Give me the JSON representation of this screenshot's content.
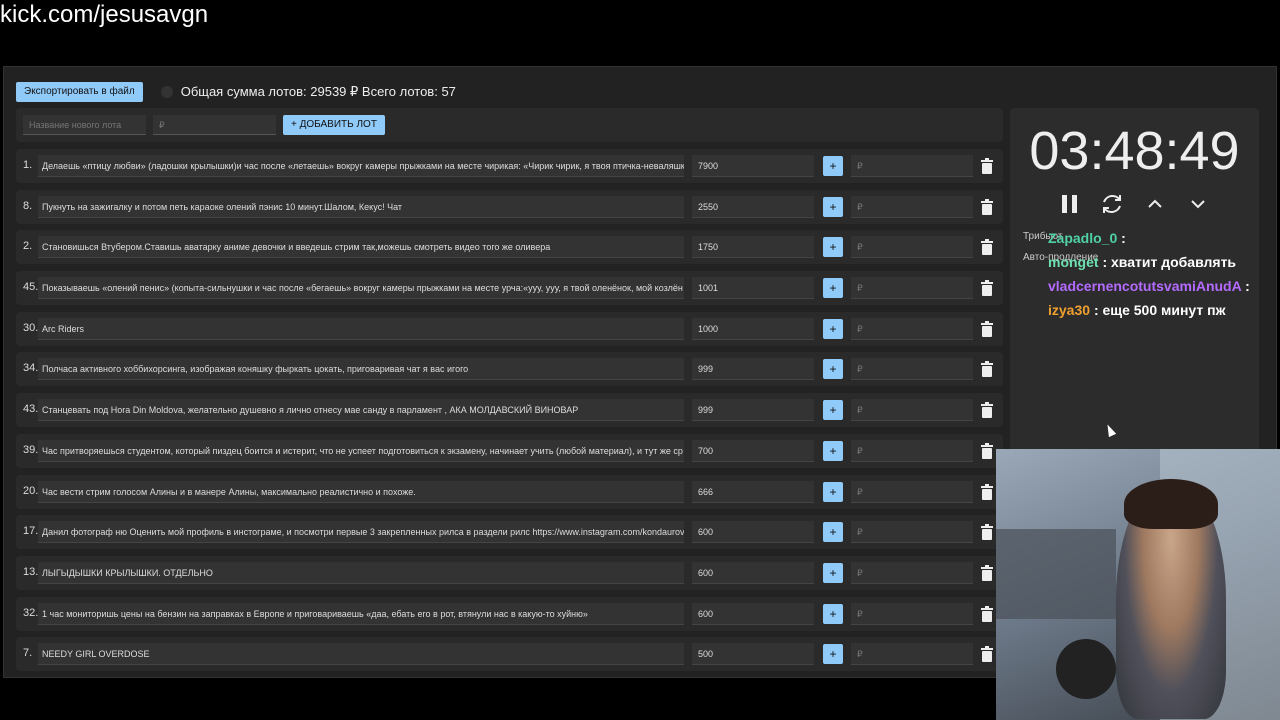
{
  "url": "kick.com/jesusavgn",
  "toolbar": {
    "export_label": "Экспортировать в файл",
    "total_text": "Общая сумма лотов: 29539 ₽ Всего лотов: 57"
  },
  "new_lot": {
    "name_placeholder": "Название нового лота",
    "amount_placeholder": "₽",
    "add_label": "+ ДОБАВИТЬ ЛОТ"
  },
  "lots": [
    {
      "num": "1.",
      "name": "Делаешь «птицу любви» (ладошки крылышки)и час после «летаешь» вокруг камеры прыжками на месте чирикая: «Чирик чирик, я твоя птичка-неваляшка",
      "amount": "7900",
      "rub": "₽"
    },
    {
      "num": "8.",
      "name": "Пукнуть на зажигалку и потом петь караоке олений пэнис 10 минут.Шалом, Кекус! Чат",
      "amount": "2550",
      "rub": "₽"
    },
    {
      "num": "2.",
      "name": "Становишься Втубером.Ставишь аватарку аниме девочки и введешь стрим так,можешь смотреть видео того же оливера",
      "amount": "1750",
      "rub": "₽"
    },
    {
      "num": "45.",
      "name": "Показываешь «олений пенис» (копыта-сильнушки и час после «бегаешь» вокруг камеры прыжками на месте урча:«ууу, ууу, я твой оленёнок, мой козлён",
      "amount": "1001",
      "rub": "₽"
    },
    {
      "num": "30.",
      "name": "Arc Riders",
      "amount": "1000",
      "rub": "₽"
    },
    {
      "num": "34.",
      "name": "Полчаса активного хоббихорсинга, изображая коняшку фыркать цокать, приговаривая чат я вас игого",
      "amount": "999",
      "rub": "₽"
    },
    {
      "num": "43.",
      "name": "Станцевать под Hora Din Moldova, желательно душевно я лично отнесу мае санду в парламент , АКА МОЛДАВСКИЙ ВИНОВАР",
      "amount": "999",
      "rub": "₽"
    },
    {
      "num": "39.",
      "name": "Час притворяешься студентом, который пиздец боится и истерит, что не успеет подготовиться к экзамену, начинает учить (любой материал), и тут же ср",
      "amount": "700",
      "rub": "₽"
    },
    {
      "num": "20.",
      "name": "Час вести стрим голосом Алины и в манере Алины, максимально реалистично и похоже.",
      "amount": "666",
      "rub": "₽"
    },
    {
      "num": "17.",
      "name": "Данил фотограф ню Оценить мой профиль в инстограме, и посмотри первые 3 закрепленных рилса в раздели рилс https://www.instagram.com/kondaurov",
      "amount": "600",
      "rub": "₽"
    },
    {
      "num": "13.",
      "name": "ЛЫГЫДЫШКИ КРЫЛЫШКИ. ОТДЕЛЬНО",
      "amount": "600",
      "rub": "₽"
    },
    {
      "num": "32.",
      "name": "1 час мониторишь цены на бензин на заправках в Европе и приговариваешь «даа, ебать его в рот, втянули нас в какую-то хуйню»",
      "amount": "600",
      "rub": "₽"
    },
    {
      "num": "7.",
      "name": "NEEDY GIRL OVERDOSE",
      "amount": "500",
      "rub": "₽"
    }
  ],
  "timer": {
    "time": "03:48:49",
    "tribute_label": "Трибьют",
    "auto_label": "Авто-продление"
  },
  "chat": [
    {
      "user": "Zapadlo_0",
      "text": ":",
      "color": "#4fd1a5"
    },
    {
      "user": "monget",
      "text": ": хватит добавлять",
      "color": "#6fe0b0"
    },
    {
      "user": "vladcernencotutsvamiAnudA",
      "text": ":",
      "color": "#b46bff"
    },
    {
      "user": "izya30",
      "text": ": еще 500 минут пж",
      "color": "#f0a030"
    }
  ]
}
